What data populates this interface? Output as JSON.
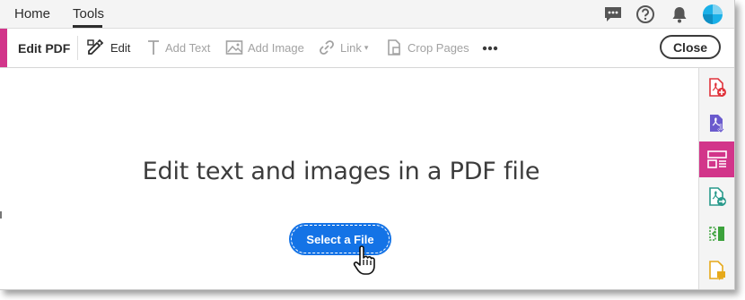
{
  "nav": {
    "home_label": "Home",
    "tools_label": "Tools",
    "icons": [
      "chat-icon",
      "help-icon",
      "bell-icon",
      "profile-avatar"
    ]
  },
  "toolbar": {
    "title": "Edit PDF",
    "tools": [
      {
        "label": "Edit",
        "icon": "edit-icon",
        "enabled": true
      },
      {
        "label": "Add Text",
        "icon": "text-icon",
        "enabled": false
      },
      {
        "label": "Add Image",
        "icon": "image-icon",
        "enabled": false
      },
      {
        "label": "Link",
        "icon": "link-icon",
        "enabled": false
      },
      {
        "label": "Crop Pages",
        "icon": "crop-icon",
        "enabled": false
      }
    ],
    "more_label": "•••",
    "close_label": "Close"
  },
  "main": {
    "heading": "Edit text and images in a PDF file",
    "select_button_label": "Select a File"
  },
  "rail": {
    "items": [
      {
        "icon": "create-pdf-icon",
        "color": "#e0333b"
      },
      {
        "icon": "export-pdf-icon",
        "color": "#6a5acd"
      },
      {
        "icon": "edit-pdf-icon",
        "color": "#ffffff",
        "selected": true
      },
      {
        "icon": "send-pdf-icon",
        "color": "#2a9a8c"
      },
      {
        "icon": "organize-pages-icon",
        "color": "#3ca23c"
      },
      {
        "icon": "comment-icon",
        "color": "#e6a91a"
      }
    ]
  },
  "colors": {
    "accent": "#d2358a",
    "primary_button": "#1473e6",
    "avatar": "#1ab0e8"
  }
}
